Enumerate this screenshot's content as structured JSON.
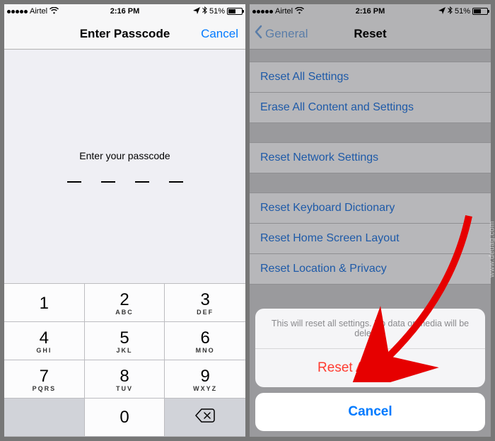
{
  "status": {
    "carrier": "Airtel",
    "time": "2:16 PM",
    "battery_pct": "51%"
  },
  "left": {
    "nav_title": "Enter Passcode",
    "nav_cancel": "Cancel",
    "prompt": "Enter your passcode",
    "keypad": {
      "k1": "1",
      "k1_sub": " ",
      "k2": "2",
      "k2_sub": "ABC",
      "k3": "3",
      "k3_sub": "DEF",
      "k4": "4",
      "k4_sub": "GHI",
      "k5": "5",
      "k5_sub": "JKL",
      "k6": "6",
      "k6_sub": "MNO",
      "k7": "7",
      "k7_sub": "PQRS",
      "k8": "8",
      "k8_sub": "TUV",
      "k9": "9",
      "k9_sub": "WXYZ",
      "k0": "0"
    }
  },
  "right": {
    "nav_back": "General",
    "nav_title": "Reset",
    "rows": {
      "reset_all": "Reset All Settings",
      "erase_all": "Erase All Content and Settings",
      "reset_network": "Reset Network Settings",
      "reset_keyboard": "Reset Keyboard Dictionary",
      "reset_home": "Reset Home Screen Layout",
      "reset_location": "Reset Location & Privacy"
    },
    "sheet": {
      "message": "This will reset all settings. No data or media will be deleted.",
      "action": "Reset All Settings",
      "cancel": "Cancel"
    }
  },
  "watermark": "www.deuag.com"
}
